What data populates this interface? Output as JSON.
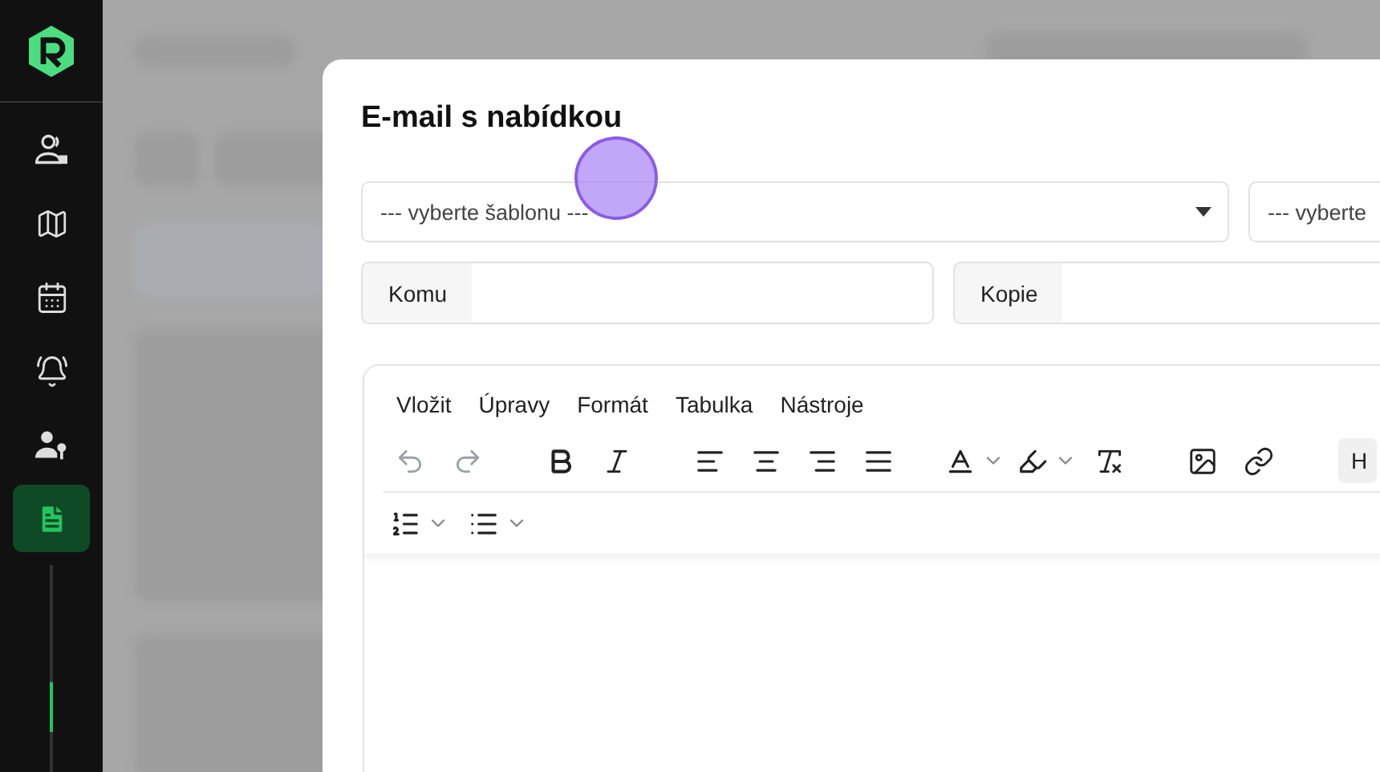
{
  "sidebar": {
    "items": [
      {
        "selected": false
      },
      {
        "selected": false
      },
      {
        "selected": false
      },
      {
        "selected": false
      },
      {
        "selected": false
      },
      {
        "selected": true
      }
    ]
  },
  "dialog": {
    "title": "E-mail s nabídkou",
    "selects": [
      {
        "placeholder": "--- vyberte šablonu ---"
      },
      {
        "placeholder": "--- vyberte"
      }
    ],
    "fields": [
      {
        "label": "Komu"
      },
      {
        "label": "Kopie"
      }
    ],
    "editor": {
      "menu": [
        "Vložit",
        "Úpravy",
        "Formát",
        "Tabulka",
        "Nástroje"
      ],
      "history": [
        {
          "disabled": true
        },
        {
          "disabled": true
        }
      ],
      "cut_button": "H"
    }
  }
}
